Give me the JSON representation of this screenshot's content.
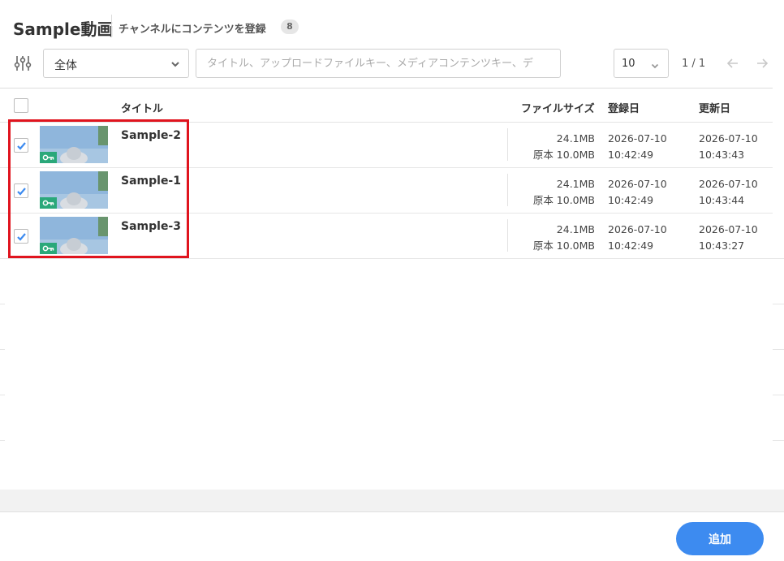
{
  "header": {
    "title": "Sample動画",
    "subtitle": "チャンネルにコンテンツを登録",
    "count": "8"
  },
  "toolbar": {
    "filter_select": "全体",
    "search_placeholder": "タイトル、アップロードファイルキー、メディアコンテンツキー、デ",
    "per_page": "10",
    "page_indicator": "1 / 1"
  },
  "table": {
    "columns": {
      "title": "タイトル",
      "file_size": "ファイルサイズ",
      "created": "登録日",
      "updated": "更新日"
    },
    "rows": [
      {
        "title": "Sample-2",
        "size": "24.1MB",
        "original": "原本 10.0MB",
        "created_date": "2026-07-10",
        "created_time": "10:42:49",
        "updated_date": "2026-07-10",
        "updated_time": "10:43:43",
        "checked": true
      },
      {
        "title": "Sample-1",
        "size": "24.1MB",
        "original": "原本 10.0MB",
        "created_date": "2026-07-10",
        "created_time": "10:42:49",
        "updated_date": "2026-07-10",
        "updated_time": "10:43:44",
        "checked": true
      },
      {
        "title": "Sample-3",
        "size": "24.1MB",
        "original": "原本 10.0MB",
        "created_date": "2026-07-10",
        "created_time": "10:42:49",
        "updated_date": "2026-07-10",
        "updated_time": "10:43:27",
        "checked": true
      }
    ]
  },
  "footer": {
    "add_label": "追加"
  },
  "colors": {
    "accent": "#3d8bf0",
    "highlight": "#e0141e",
    "key_badge": "#2aa87a"
  }
}
